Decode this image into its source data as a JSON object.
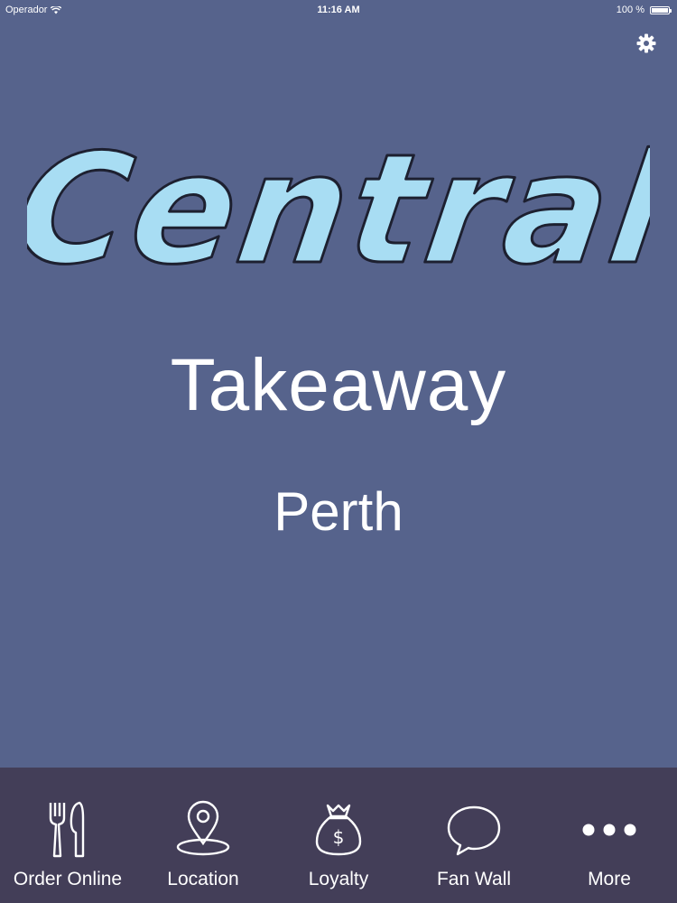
{
  "status_bar": {
    "carrier": "Operador",
    "time": "11:16 AM",
    "battery": "100 %",
    "battery_level": 1.0
  },
  "header": {
    "settings_icon": "gear-icon"
  },
  "logo": {
    "text": "Central",
    "fill_color": "#a8ddf3",
    "stroke_color": "#1d2030"
  },
  "hero": {
    "line1": "Takeaway",
    "line2": "Perth"
  },
  "colors": {
    "background": "#56638c",
    "tab_bar": "#433e58",
    "text": "#ffffff"
  },
  "tabs": [
    {
      "label": "Order Online",
      "icon": "fork-knife-icon"
    },
    {
      "label": "Location",
      "icon": "map-pin-icon"
    },
    {
      "label": "Loyalty",
      "icon": "money-bag-icon"
    },
    {
      "label": "Fan Wall",
      "icon": "speech-bubble-icon"
    },
    {
      "label": "More",
      "icon": "more-dots-icon"
    }
  ]
}
